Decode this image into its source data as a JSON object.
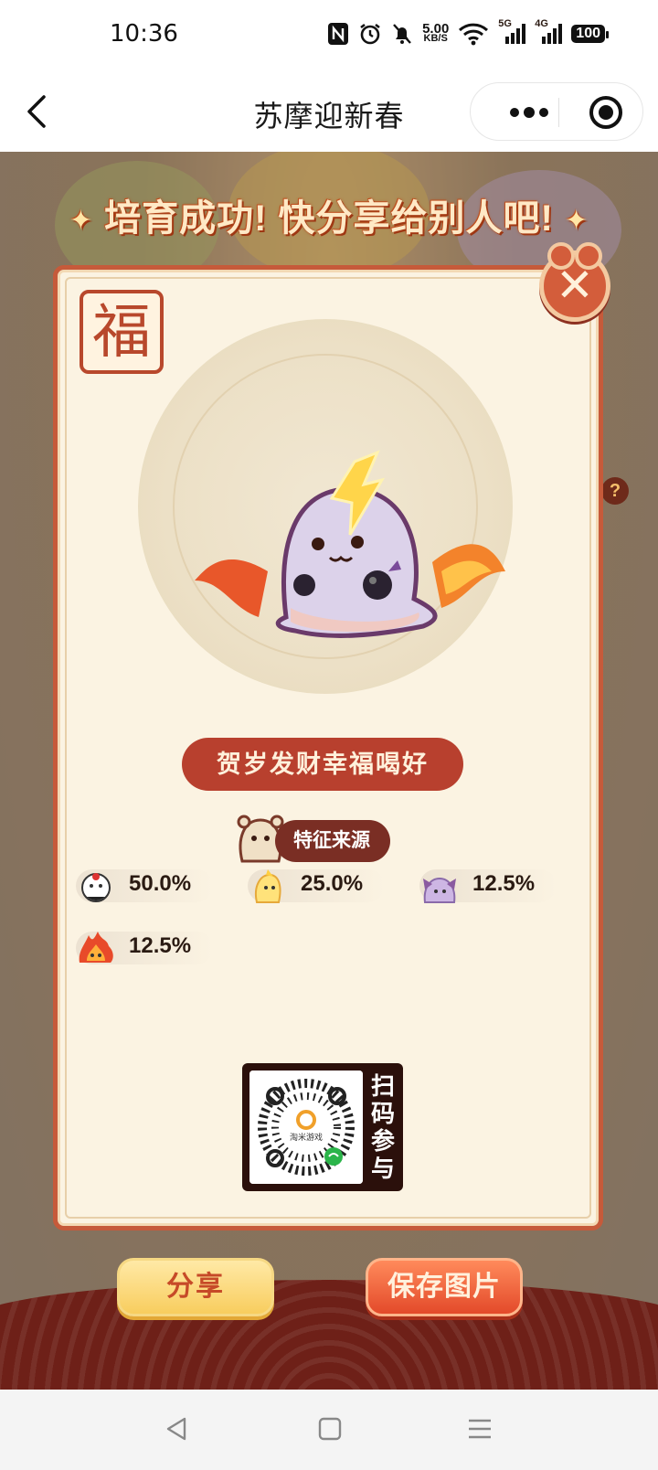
{
  "status_bar": {
    "time": "10:36",
    "speed_value": "5.00",
    "speed_unit": "KB/S",
    "network_1": "5G",
    "network_2": "4G",
    "battery": "100",
    "icons": [
      "nfc-icon",
      "alarm-icon",
      "mute-icon",
      "wifi-icon",
      "signal-5g-icon",
      "signal-4g-icon",
      "battery-icon"
    ]
  },
  "nav": {
    "title": "苏摩迎新春",
    "back_icon": "chevron-left-icon",
    "more_icon": "more-dots-icon",
    "close_icon": "target-circle-icon"
  },
  "game": {
    "headline": "培育成功! 快分享给别人吧!",
    "headline_spark": "✦",
    "fu_char": "福",
    "close_label": "✕",
    "help_label": "?",
    "pet_name": "贺岁发财幸福喝好",
    "source_title": "特征来源",
    "traits": [
      {
        "avatar": "white-ghost-creature-icon",
        "percent": "50.0%"
      },
      {
        "avatar": "yellow-chick-creature-icon",
        "percent": "25.0%"
      },
      {
        "avatar": "purple-bat-creature-icon",
        "percent": "12.5%"
      },
      {
        "avatar": "fire-creature-icon",
        "percent": "12.5%"
      }
    ],
    "qr_caption": "扫码参与",
    "qr_logo_text": "淘米游戏",
    "share_button": "分享",
    "save_button": "保存图片"
  },
  "colors": {
    "card_border": "#c65a3a",
    "name_badge": "#b8402e",
    "share_button": "#f8cd5e",
    "save_button": "#e34a2a"
  },
  "system_nav": {
    "icons": [
      "back-triangle-icon",
      "home-square-icon",
      "menu-lines-icon"
    ]
  }
}
